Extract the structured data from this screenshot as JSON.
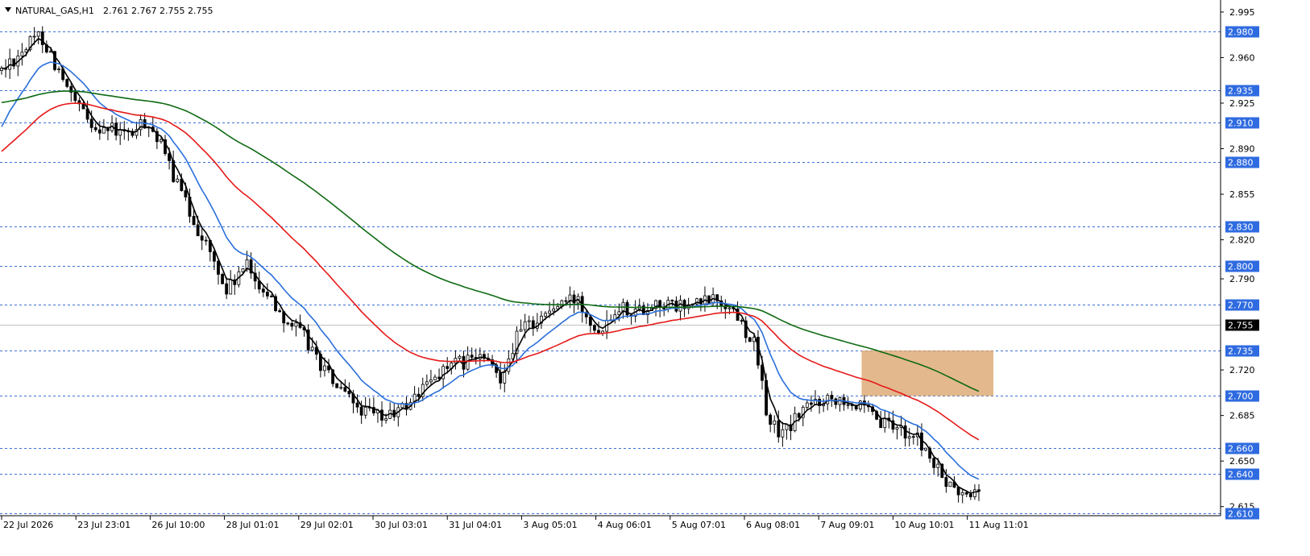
{
  "header": {
    "symbol": "NATURAL_GAS,H1",
    "ohlc": "2.761 2.767 2.755 2.755"
  },
  "chart_data": {
    "type": "candlestick",
    "symbol": "NATURAL_GAS",
    "timeframe": "H1",
    "current_price": "2.755",
    "ylim": [
      2.608,
      3.003
    ],
    "y_ticks": [
      "2.995",
      "2.960",
      "2.925",
      "2.890",
      "2.855",
      "2.820",
      "2.790",
      "2.720",
      "2.685",
      "2.650",
      "2.615"
    ],
    "x_labels": [
      "22 Jul 2026",
      "23 Jul 23:01",
      "26 Jul 10:00",
      "28 Jul 01:01",
      "29 Jul 02:01",
      "30 Jul 03:01",
      "31 Jul 04:01",
      "3 Aug 05:01",
      "4 Aug 06:01",
      "5 Aug 07:01",
      "6 Aug 08:01",
      "7 Aug 09:01",
      "10 Aug 10:01",
      "11 Aug 11:01"
    ],
    "levels": [
      "2.980",
      "2.935",
      "2.910",
      "2.880",
      "2.830",
      "2.800",
      "2.770",
      "2.735",
      "2.700",
      "2.660",
      "2.640",
      "2.610"
    ],
    "zone": {
      "from_time": "7 Aug 09:01",
      "price_top": 2.735,
      "price_bottom": 2.7,
      "color": "#d9a066"
    },
    "price_path": [
      [
        0,
        2.95
      ],
      [
        0.02,
        2.965
      ],
      [
        0.04,
        2.978
      ],
      [
        0.055,
        2.955
      ],
      [
        0.07,
        2.93
      ],
      [
        0.09,
        2.91
      ],
      [
        0.11,
        2.905
      ],
      [
        0.13,
        2.9
      ],
      [
        0.15,
        2.912
      ],
      [
        0.17,
        2.88
      ],
      [
        0.19,
        2.845
      ],
      [
        0.21,
        2.815
      ],
      [
        0.23,
        2.78
      ],
      [
        0.25,
        2.8
      ],
      [
        0.27,
        2.78
      ],
      [
        0.29,
        2.76
      ],
      [
        0.31,
        2.745
      ],
      [
        0.33,
        2.72
      ],
      [
        0.35,
        2.7
      ],
      [
        0.37,
        2.688
      ],
      [
        0.39,
        2.683
      ],
      [
        0.41,
        2.69
      ],
      [
        0.43,
        2.705
      ],
      [
        0.45,
        2.72
      ],
      [
        0.47,
        2.725
      ],
      [
        0.49,
        2.73
      ],
      [
        0.51,
        2.715
      ],
      [
        0.53,
        2.75
      ],
      [
        0.55,
        2.76
      ],
      [
        0.57,
        2.77
      ],
      [
        0.59,
        2.775
      ],
      [
        0.61,
        2.75
      ],
      [
        0.63,
        2.77
      ],
      [
        0.65,
        2.765
      ],
      [
        0.67,
        2.772
      ],
      [
        0.69,
        2.768
      ],
      [
        0.71,
        2.77
      ],
      [
        0.73,
        2.775
      ],
      [
        0.75,
        2.765
      ],
      [
        0.77,
        2.74
      ],
      [
        0.785,
        2.68
      ],
      [
        0.8,
        2.67
      ],
      [
        0.82,
        2.69
      ],
      [
        0.84,
        2.698
      ],
      [
        0.86,
        2.7
      ],
      [
        0.88,
        2.69
      ],
      [
        0.9,
        2.678
      ],
      [
        0.92,
        2.675
      ],
      [
        0.94,
        2.665
      ],
      [
        0.955,
        2.645
      ],
      [
        0.97,
        2.63
      ],
      [
        0.985,
        2.622
      ],
      [
        1.0,
        2.628
      ]
    ],
    "series": [
      {
        "name": "",
        "color": "#000000"
      },
      {
        "name": "",
        "color": "#2a6fdb"
      },
      {
        "name": "",
        "color": "#e61919"
      },
      {
        "name": "",
        "color": "#0f6a12"
      }
    ],
    "grid": false
  }
}
